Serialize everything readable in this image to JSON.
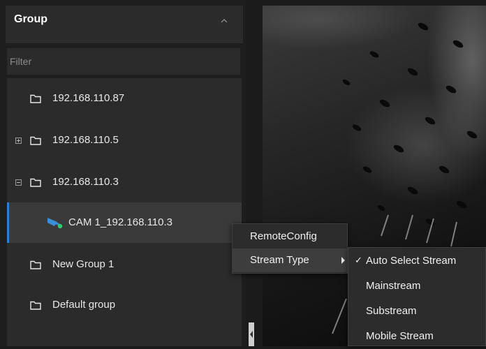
{
  "group_panel": {
    "title": "Group",
    "filter_placeholder": "Filter",
    "collapse_icon": "chevron-up-icon"
  },
  "tree": {
    "items": [
      {
        "label": "192.168.110.87",
        "icon": "folder-icon",
        "expander": "none"
      },
      {
        "label": "192.168.110.5",
        "icon": "folder-icon",
        "expander": "expand"
      },
      {
        "label": "192.168.110.3",
        "icon": "folder-icon",
        "expander": "collapse"
      },
      {
        "label": "CAM 1_192.168.110.3",
        "icon": "camera-online-icon",
        "selected": true
      },
      {
        "label": "New Group 1",
        "icon": "folder-icon"
      },
      {
        "label": "Default group",
        "icon": "folder-icon"
      }
    ]
  },
  "context_menu": {
    "items": [
      {
        "label": "RemoteConfig"
      },
      {
        "label": "Stream Type",
        "has_submenu": true
      }
    ]
  },
  "stream_submenu": {
    "check_mark": "✓",
    "items": [
      {
        "label": "Auto Select Stream",
        "checked": true
      },
      {
        "label": "Mainstream"
      },
      {
        "label": "Substream"
      },
      {
        "label": "Mobile Stream"
      }
    ]
  },
  "colors": {
    "selection_accent": "#2d7fd3",
    "camera_icon": "#3a8fd8",
    "online_dot": "#2ecc71"
  }
}
